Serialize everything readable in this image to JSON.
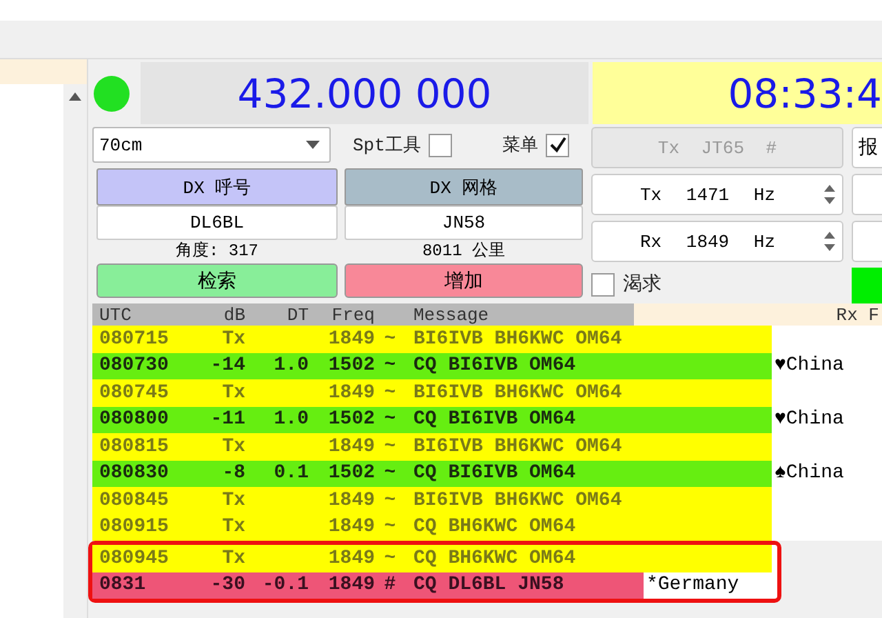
{
  "status_light": {
    "on": true
  },
  "frequency": "432.000 000",
  "clock": "08:33:4",
  "controls": {
    "band": "70cm",
    "spt_tools": {
      "label": "Spt工具",
      "checked": false
    },
    "menu": {
      "label": "菜单",
      "checked": true
    },
    "dx_call": {
      "label": "DX 呼号",
      "value": "DL6BL",
      "info": "角度: 317"
    },
    "dx_grid": {
      "label": "DX 网格",
      "value": "JN58",
      "info": "8011 公里"
    },
    "lookup_button": "检索",
    "add_button": "增加"
  },
  "tx_panel": {
    "mode_button": "Tx JT65 #",
    "tx_freq": "Tx 1471 Hz",
    "rx_freq": "Rx 1849 Hz",
    "eager": {
      "label": "渴求",
      "checked": false
    },
    "side_button": "报",
    "side_indicator": {
      "on": true
    }
  },
  "decodes": {
    "columns": [
      "UTC",
      "dB",
      "DT",
      "Freq",
      "Message"
    ],
    "rx_column": "Rx F",
    "rows": [
      {
        "kind": "tx",
        "utc": "080715",
        "db": "Tx",
        "freq": "1849",
        "mode": "~",
        "message": "BI6IVB BH6KWC OM64",
        "highlighted": false
      },
      {
        "kind": "cq",
        "utc": "080730",
        "db": "-14",
        "dt": "1.0",
        "freq": "1502",
        "mode": "~",
        "message": "CQ BI6IVB OM64",
        "country": "♥China",
        "highlighted": false
      },
      {
        "kind": "tx",
        "utc": "080745",
        "db": "Tx",
        "freq": "1849",
        "mode": "~",
        "message": "BI6IVB BH6KWC OM64",
        "highlighted": false
      },
      {
        "kind": "cq",
        "utc": "080800",
        "db": "-11",
        "dt": "1.0",
        "freq": "1502",
        "mode": "~",
        "message": "CQ BI6IVB OM64",
        "country": "♥China",
        "highlighted": false
      },
      {
        "kind": "tx",
        "utc": "080815",
        "db": "Tx",
        "freq": "1849",
        "mode": "~",
        "message": "BI6IVB BH6KWC OM64",
        "highlighted": false
      },
      {
        "kind": "cq",
        "utc": "080830",
        "db": "-8",
        "dt": "0.1",
        "freq": "1502",
        "mode": "~",
        "message": "CQ BI6IVB OM64",
        "country": "♠China",
        "highlighted": false
      },
      {
        "kind": "tx",
        "utc": "080845",
        "db": "Tx",
        "freq": "1849",
        "mode": "~",
        "message": "BI6IVB BH6KWC OM64",
        "highlighted": false
      },
      {
        "kind": "tx",
        "utc": "080915",
        "db": "Tx",
        "freq": "1849",
        "mode": "~",
        "message": "CQ BH6KWC OM64",
        "highlighted": false
      },
      {
        "kind": "tx",
        "utc": "080945",
        "db": "Tx",
        "freq": "1849",
        "mode": "~",
        "message": "CQ BH6KWC OM64",
        "highlighted": true
      },
      {
        "kind": "new",
        "utc": "0831",
        "db": "-30",
        "dt": "-0.1",
        "freq": "1849",
        "mode": "#",
        "message": "CQ DL6BL JN58",
        "country": "*Germany",
        "highlighted": true
      }
    ]
  }
}
